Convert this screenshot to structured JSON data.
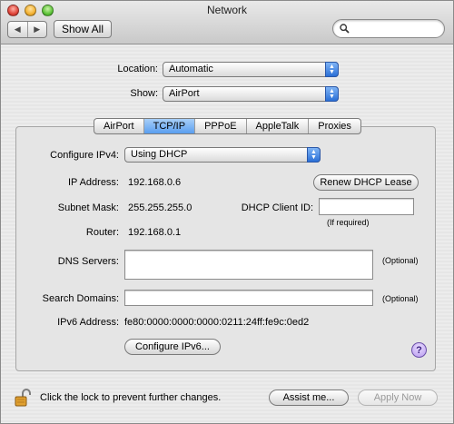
{
  "window": {
    "title": "Network"
  },
  "toolbar": {
    "back_glyph": "◀",
    "forward_glyph": "▶",
    "show_all_label": "Show All",
    "search_value": ""
  },
  "location": {
    "label": "Location:",
    "value": "Automatic"
  },
  "show": {
    "label": "Show:",
    "value": "AirPort"
  },
  "tabs": [
    {
      "label": "AirPort",
      "active": false
    },
    {
      "label": "TCP/IP",
      "active": true
    },
    {
      "label": "PPPoE",
      "active": false
    },
    {
      "label": "AppleTalk",
      "active": false
    },
    {
      "label": "Proxies",
      "active": false
    }
  ],
  "tcpip": {
    "configure_label": "Configure IPv4:",
    "configure_value": "Using DHCP",
    "ip_label": "IP Address:",
    "ip_value": "192.168.0.6",
    "renew_label": "Renew DHCP Lease",
    "subnet_label": "Subnet Mask:",
    "subnet_value": "255.255.255.0",
    "client_id_label": "DHCP Client ID:",
    "client_id_value": "",
    "if_required": "(If required)",
    "router_label": "Router:",
    "router_value": "192.168.0.1",
    "dns_label": "DNS Servers:",
    "dns_value": "",
    "optional": "(Optional)",
    "search_domains_label": "Search Domains:",
    "search_domains_value": "",
    "ipv6_label": "IPv6 Address:",
    "ipv6_value": "fe80:0000:0000:0000:0211:24ff:fe9c:0ed2",
    "configure_ipv6_label": "Configure IPv6...",
    "help_glyph": "?"
  },
  "footer": {
    "lock_text": "Click the lock to prevent further changes.",
    "assist_label": "Assist me...",
    "apply_label": "Apply Now"
  },
  "icons": {
    "help": "question-mark-icon",
    "lock": "open-lock-icon",
    "search": "magnifier-icon"
  }
}
